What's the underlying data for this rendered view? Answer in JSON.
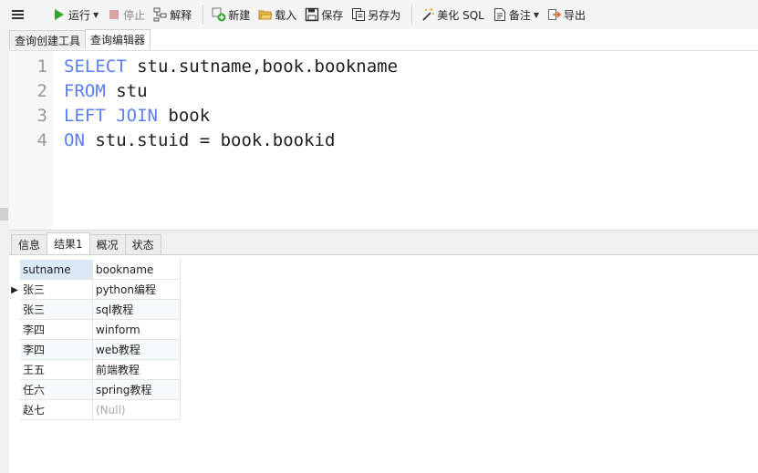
{
  "toolbar": {
    "run": "运行",
    "stop": "停止",
    "explain": "解释",
    "new": "新建",
    "load": "载入",
    "save": "保存",
    "save_as": "另存为",
    "beautify": "美化 SQL",
    "note": "备注",
    "export": "导出"
  },
  "top_tabs": [
    "查询创建工具",
    "查询编辑器"
  ],
  "editor": {
    "line_numbers": [
      "1",
      "2",
      "3",
      "4"
    ],
    "lines": [
      {
        "kw1": "SELECT",
        "kw2": "",
        "rest": " stu.sutname,book.bookname"
      },
      {
        "kw1": "FROM",
        "kw2": "",
        "rest": " stu"
      },
      {
        "kw1": "LEFT",
        "kw2": " JOIN",
        "rest": " book"
      },
      {
        "kw1": "ON",
        "kw2": "",
        "rest": " stu.stuid = book.bookid"
      }
    ]
  },
  "result_tabs": [
    "信息",
    "结果1",
    "概况",
    "状态"
  ],
  "grid": {
    "columns": [
      "sutname",
      "bookname"
    ],
    "rows": [
      [
        "张三",
        "python编程"
      ],
      [
        "张三",
        "sql教程"
      ],
      [
        "李四",
        "winform"
      ],
      [
        "李四",
        "web教程"
      ],
      [
        "王五",
        "前端教程"
      ],
      [
        "任六",
        "spring教程"
      ],
      [
        "赵七",
        "(Null)"
      ]
    ]
  },
  "colors": {
    "keyword": "#5a7ff2",
    "run_icon": "#2fa52f",
    "stop_icon": "#d9a3a3",
    "header_selected": "#dbe9f7"
  }
}
